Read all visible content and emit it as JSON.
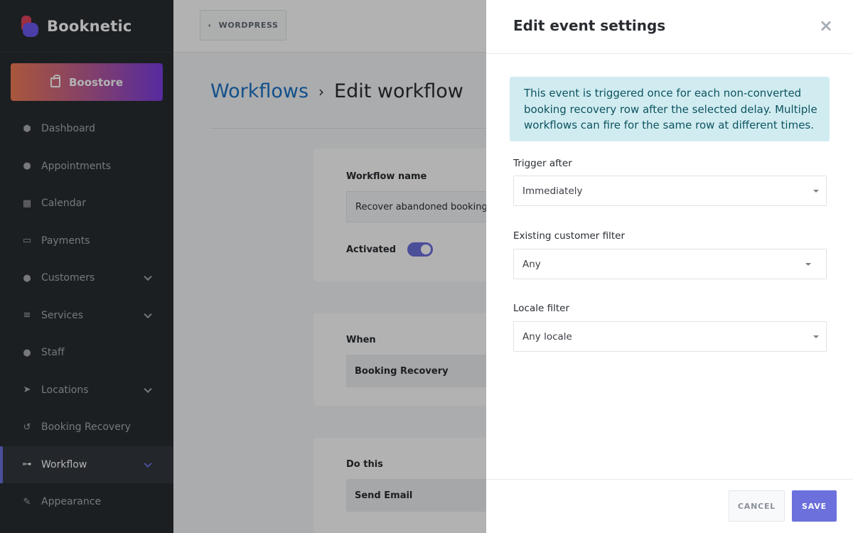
{
  "sidebar": {
    "brand": "Booknetic",
    "boostore": "Boostore",
    "items": [
      {
        "label": "Dashboard",
        "icon": "cube-icon"
      },
      {
        "label": "Appointments",
        "icon": "clock-icon"
      },
      {
        "label": "Calendar",
        "icon": "calendar-icon"
      },
      {
        "label": "Payments",
        "icon": "credit-card-icon"
      },
      {
        "label": "Customers",
        "icon": "users-icon"
      },
      {
        "label": "Services",
        "icon": "list-icon"
      },
      {
        "label": "Staff",
        "icon": "user-icon"
      },
      {
        "label": "Locations",
        "icon": "location-arrow-icon"
      },
      {
        "label": "Booking Recovery",
        "icon": "undo-icon"
      },
      {
        "label": "Workflow",
        "icon": "workflow-icon"
      },
      {
        "label": "Appearance",
        "icon": "brush-icon"
      }
    ],
    "active": "Workflow"
  },
  "topbar": {
    "wordpress_label": "WORDPRESS"
  },
  "page": {
    "breadcrumb_link": "Workflows",
    "breadcrumb_sep": "›",
    "breadcrumb_current": "Edit workflow"
  },
  "workflow": {
    "name_label": "Workflow name",
    "name_value": "Recover abandoned booking",
    "activated_label": "Activated",
    "activated": true,
    "when_label": "When",
    "when_value": "Booking Recovery",
    "do_label": "Do this",
    "do_value": "Send Email"
  },
  "drawer": {
    "title": "Edit event settings",
    "close_glyph": "×",
    "info": "This event is triggered once for each non-converted booking recovery row after the selected delay. Multiple workflows can fire for the same row at different times.",
    "fields": {
      "trigger_after": {
        "label": "Trigger after",
        "value": "Immediately"
      },
      "customer_filter": {
        "label": "Existing customer filter",
        "value": "Any"
      },
      "locale_filter": {
        "label": "Locale filter",
        "value": "Any locale"
      }
    },
    "cancel_label": "CANCEL",
    "save_label": "SAVE"
  },
  "colors": {
    "accent": "#6c70dc",
    "sidebar_bg": "#292d32",
    "info_bg": "#d1ecf1",
    "info_text": "#0c5460",
    "link": "#1a73c7"
  }
}
